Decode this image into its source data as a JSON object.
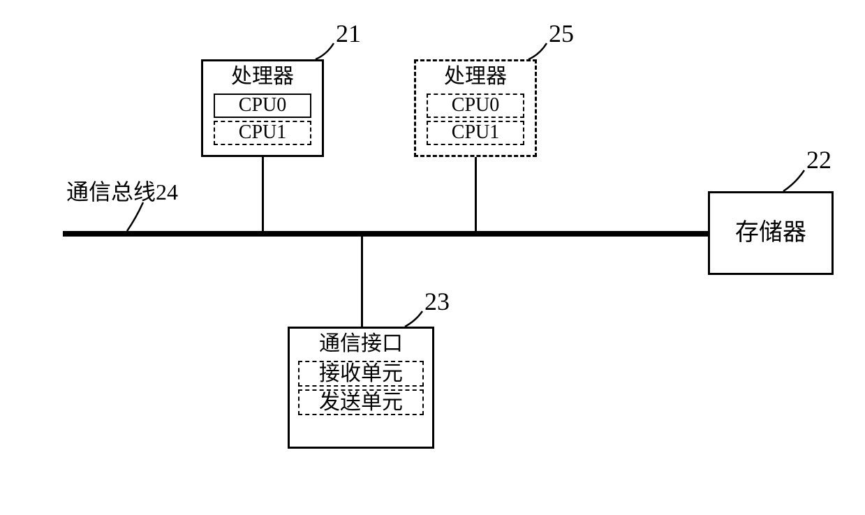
{
  "labels": {
    "num21": "21",
    "num25": "25",
    "num22": "22",
    "num23": "23",
    "bus_label": "通信总线24"
  },
  "proc21": {
    "title": "处理器",
    "cpu0": "CPU0",
    "cpu1": "CPU1"
  },
  "proc25": {
    "title": "处理器",
    "cpu0": "CPU0",
    "cpu1": "CPU1"
  },
  "mem22": {
    "title": "存储器"
  },
  "comm23": {
    "title": "通信接口",
    "rx": "接收单元",
    "tx": "发送单元"
  }
}
